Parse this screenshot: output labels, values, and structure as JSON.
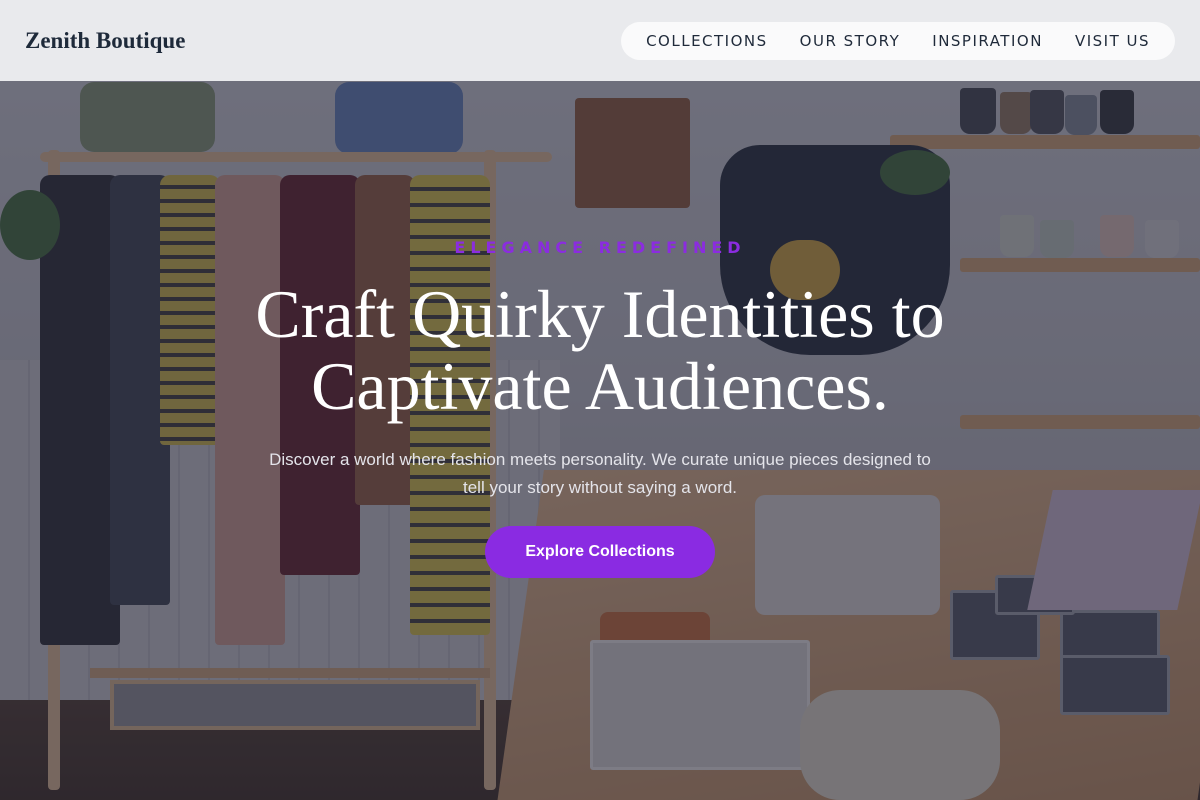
{
  "header": {
    "logo": "Zenith Boutique",
    "nav": [
      "COLLECTIONS",
      "OUR STORY",
      "INSPIRATION",
      "VISIT US"
    ]
  },
  "hero": {
    "eyebrow": "ELEGANCE REDEFINED",
    "headline_line1": "Craft Quirky Identities to",
    "headline_line2": "Captivate Audiences.",
    "subtext": "Discover a world where fashion meets personality. We curate unique pieces designed to tell your story without saying a word.",
    "cta_label": "Explore Collections"
  },
  "colors": {
    "accent": "#8a2be2",
    "header_bg": "#f2f3f5",
    "logo_text": "#1e2a3a",
    "headline_text": "#ffffff"
  }
}
